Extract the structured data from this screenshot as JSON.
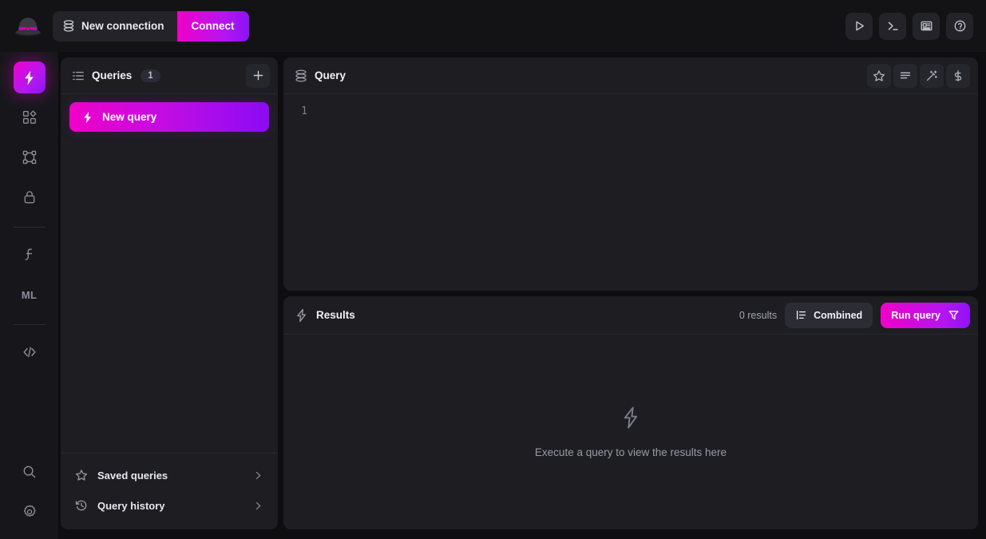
{
  "app": {
    "logo_icon": "bowler-hat-logo",
    "accent_from": "#f000c8",
    "accent_to": "#8b0bf5"
  },
  "topbar": {
    "connection_label": "New connection",
    "connection_icon": "database-icon",
    "connect_label": "Connect",
    "actions": [
      {
        "name": "run-icon",
        "label": "Run"
      },
      {
        "name": "terminal-icon",
        "label": "Terminal"
      },
      {
        "name": "news-icon",
        "label": "News"
      },
      {
        "name": "help-icon",
        "label": "Help"
      }
    ]
  },
  "rail": {
    "items": [
      {
        "name": "sidebar-item-query",
        "icon": "lightning-icon",
        "label": "Query",
        "active": true
      },
      {
        "name": "sidebar-item-dashboards",
        "icon": "grid-icon",
        "label": "Dashboards",
        "active": false
      },
      {
        "name": "sidebar-item-graph",
        "icon": "nodes-icon",
        "label": "Graph",
        "active": false
      },
      {
        "name": "sidebar-item-security",
        "icon": "lock-icon",
        "label": "Security",
        "active": false
      },
      {
        "name": "sidebar-item-functions",
        "icon": "function-icon",
        "label": "ƒ",
        "active": false
      },
      {
        "name": "sidebar-item-ml",
        "icon": "ml-icon",
        "label": "ML",
        "active": false
      },
      {
        "name": "sidebar-item-code",
        "icon": "code-icon",
        "label": "Code",
        "active": false
      }
    ],
    "bottom": [
      {
        "name": "sidebar-item-search",
        "icon": "search-icon",
        "label": "Search"
      },
      {
        "name": "sidebar-item-settings",
        "icon": "gear-icon",
        "label": "Settings"
      }
    ]
  },
  "queries": {
    "title": "Queries",
    "count": "1",
    "header_icon": "list-icon",
    "add_label": "+",
    "items": [
      {
        "label": "New query",
        "icon": "lightning-icon",
        "active": true
      }
    ],
    "footer": [
      {
        "label": "Saved queries",
        "icon": "star-icon"
      },
      {
        "label": "Query history",
        "icon": "history-icon"
      }
    ]
  },
  "query": {
    "title": "Query",
    "header_icon": "database-icon",
    "tools": [
      {
        "name": "save-star-button",
        "icon": "star-icon"
      },
      {
        "name": "format-button",
        "icon": "format-lines-icon"
      },
      {
        "name": "magic-button",
        "icon": "magic-wand-icon"
      },
      {
        "name": "cost-button",
        "icon": "dollar-icon"
      }
    ],
    "line_number": "1",
    "code": ""
  },
  "results": {
    "title": "Results",
    "header_icon": "lightning-icon",
    "count_label": "0 results",
    "combined_label": "Combined",
    "combined_icon": "list-indent-icon",
    "run_label": "Run query",
    "run_icon": "funnel-icon",
    "empty_icon": "lightning-icon",
    "empty_text": "Execute a query to view the results here"
  }
}
